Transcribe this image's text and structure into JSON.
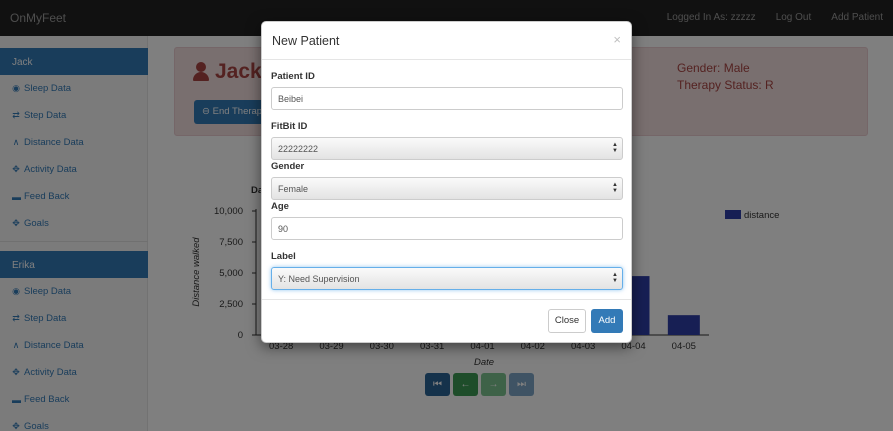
{
  "navbar": {
    "brand": "OnMyFeet",
    "logged_in": "Logged In As: zzzzz",
    "logout": "Log Out",
    "add_patient": "Add Patient"
  },
  "sidebar": {
    "patients": [
      {
        "name": "Jack",
        "items": [
          {
            "label": "Sleep Data",
            "icon": "eye-icon"
          },
          {
            "label": "Step Data",
            "icon": "transfer-icon"
          },
          {
            "label": "Distance Data",
            "icon": "road-icon"
          },
          {
            "label": "Activity Data",
            "icon": "move-icon"
          },
          {
            "label": "Feed Back",
            "icon": "comment-icon"
          },
          {
            "label": "Goals",
            "icon": "move-icon"
          }
        ]
      },
      {
        "name": "Erika",
        "items": [
          {
            "label": "Sleep Data",
            "icon": "eye-icon"
          },
          {
            "label": "Step Data",
            "icon": "transfer-icon"
          },
          {
            "label": "Distance Data",
            "icon": "road-icon"
          },
          {
            "label": "Activity Data",
            "icon": "move-icon"
          },
          {
            "label": "Feed Back",
            "icon": "comment-icon"
          },
          {
            "label": "Goals",
            "icon": "move-icon"
          }
        ]
      }
    ]
  },
  "patient_panel": {
    "name": "Jack",
    "end_therapy": "End Therapy",
    "gender": "Gender: Male",
    "therapy_status": "Therapy Status: R"
  },
  "chart_data": {
    "type": "bar",
    "title": "",
    "title_fragment": "Da",
    "xlabel": "Date",
    "ylabel": "Distance walked",
    "ylim": [
      0,
      10000
    ],
    "yticks": [
      "0",
      "2,500",
      "5,000",
      "7,500",
      "10,000"
    ],
    "categories": [
      "03-28",
      "03-29",
      "03-30",
      "03-31",
      "04-01",
      "04-02",
      "04-03",
      "04-04",
      "04-05"
    ],
    "series": [
      {
        "name": "distance",
        "color": "#2e3fa8",
        "values": [
          null,
          null,
          null,
          null,
          null,
          null,
          null,
          4750,
          1600
        ]
      }
    ],
    "legend_position": "top-right",
    "grid": false
  },
  "chart_controls": [
    {
      "name": "first-page-button",
      "glyph": "⏮",
      "color": "#2a6496"
    },
    {
      "name": "prev-button",
      "glyph": "←",
      "color": "#3d9b55"
    },
    {
      "name": "next-button",
      "glyph": "→",
      "color": "#7cc590"
    },
    {
      "name": "last-page-button",
      "glyph": "⏭",
      "color": "#7fa6c9"
    }
  ],
  "modal": {
    "title": "New Patient",
    "close_glyph": "×",
    "patient_id_label": "Patient ID",
    "patient_id_value": "Beibei",
    "fitbit_label": "FitBit ID",
    "fitbit_value": "22222222",
    "gender_label": "Gender",
    "gender_value": "Female",
    "age_label": "Age",
    "age_value": "90",
    "label_label": "Label",
    "label_value": "Y: Need Supervision",
    "close_button": "Close",
    "add_button": "Add"
  },
  "colors": {
    "navbar": "#222222",
    "primary": "#337ab7",
    "danger_text": "#a94442",
    "danger_bg": "#f2dede"
  }
}
